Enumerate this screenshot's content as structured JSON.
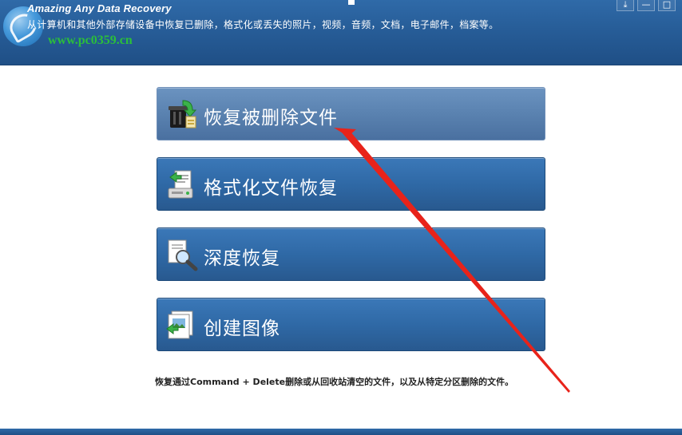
{
  "header": {
    "title": "Amazing Any Data Recovery",
    "description": "从计算机和其他外部存储设备中恢复已删除，格式化或丢失的照片，视频，音频，文档，电子邮件，档案等。",
    "watermark": "www.pc0359.cn"
  },
  "window_controls": [
    {
      "name": "export-icon",
      "glyph": "⤓"
    },
    {
      "name": "minimize-icon",
      "glyph": "—"
    },
    {
      "name": "maximize-icon",
      "glyph": "□"
    }
  ],
  "actions": [
    {
      "label": "恢复被删除文件",
      "icon": "trash-restore-icon"
    },
    {
      "label": "格式化文件恢复",
      "icon": "drive-format-icon"
    },
    {
      "label": "深度恢复",
      "icon": "magnifier-doc-icon"
    },
    {
      "label": "创建图像",
      "icon": "image-create-icon"
    }
  ],
  "hint": "恢复通过Command + Delete删除或从回收站清空的文件，以及从特定分区删除的文件。",
  "colors": {
    "header": "#275d98",
    "button": "#2f69a6",
    "button_selected": "#5a82b0",
    "arrow": "#e8231a",
    "watermark": "#2bbf3a"
  }
}
